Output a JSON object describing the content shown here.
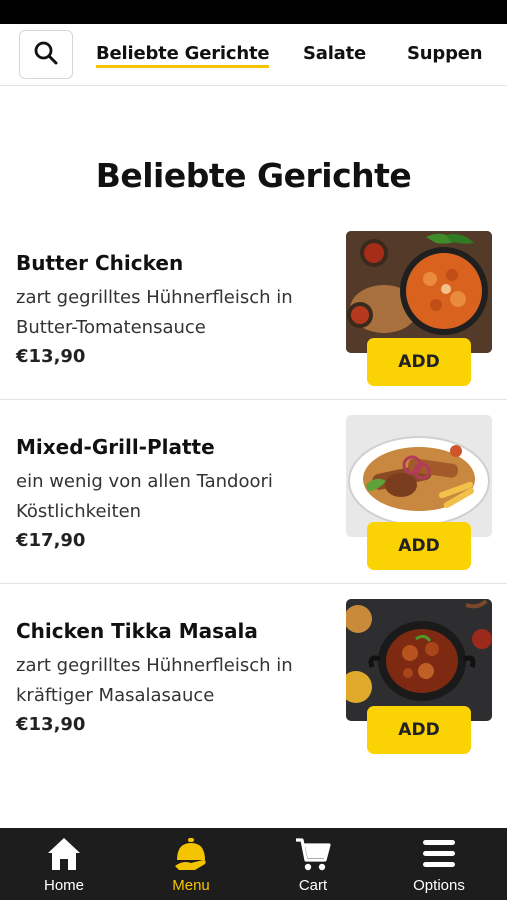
{
  "top_nav": {
    "tabs": [
      {
        "label": "Beliebte Gerichte",
        "active": true
      },
      {
        "label": "Salate",
        "active": false
      },
      {
        "label": "Suppen",
        "active": false
      }
    ],
    "search_icon": "search-icon"
  },
  "section": {
    "title": "Beliebte Gerichte"
  },
  "items": [
    {
      "name": "Butter Chicken",
      "description": "zart gegrilltes Hühnerfleisch in Butter-Tomatensauce",
      "price": "€13,90",
      "add_label": "ADD"
    },
    {
      "name": "Mixed-Grill-Platte",
      "description": "ein wenig von allen Tandoori Köstlichkeiten",
      "price": "€17,90",
      "add_label": "ADD"
    },
    {
      "name": "Chicken Tikka Masala",
      "description": "zart gegrilltes Hühnerfleisch in kräftiger Masalasauce",
      "price": "€13,90",
      "add_label": "ADD"
    }
  ],
  "bottom_nav": [
    {
      "label": "Home",
      "icon": "home-icon",
      "active": false
    },
    {
      "label": "Menu",
      "icon": "cloche-icon",
      "active": true
    },
    {
      "label": "Cart",
      "icon": "cart-icon",
      "active": false
    },
    {
      "label": "Options",
      "icon": "menu-icon",
      "active": false
    }
  ],
  "colors": {
    "accent": "#fbd204",
    "nav_background": "#1d1d1d",
    "active_nav": "#f5c400"
  }
}
